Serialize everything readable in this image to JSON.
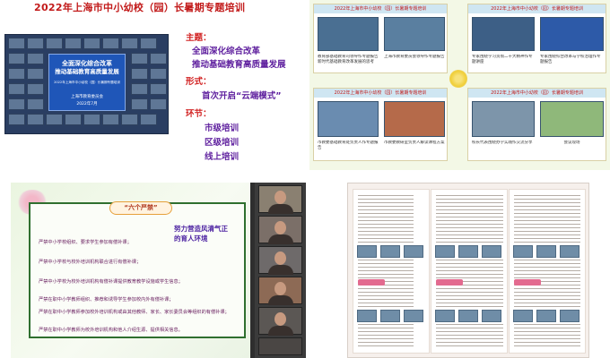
{
  "top_left": {
    "title": "2022年上海市中小幼校（园）长暑期专题培训",
    "theme_label": "主题：",
    "theme_line1": "全面深化综合改革",
    "theme_line2": "推动基础教育高质量发展",
    "form_label": "形式：",
    "form_text": "首次开启“云端模式”",
    "stage_label": "环节：",
    "stages": [
      "市级培训",
      "区级培训",
      "线上培训"
    ],
    "screen_lines": [
      "全面深化综合改革",
      "推动基础教育高质量发展",
      "2022年上海市中小幼校（园）长暑期专题培训",
      "上海市教育委员会",
      "2022年7月"
    ]
  },
  "top_right": {
    "cards": [
      {
        "header": "2022年上海市中小幼校（园）长暑期专题培训",
        "caption_a": "教育部基础教育司领导作专题报告 新时代基础教育改革发展的思考",
        "caption_b": "上海市教育委员会领导作专题报告"
      },
      {
        "header": "2022年上海市中小幼校（园）长暑期专题培训",
        "caption_a": "专家围绕学习贯彻二十大精神作专题讲座",
        "caption_b": "专家围绕综合改革与学校治理作专题报告"
      },
      {
        "header": "2022年上海市中小幼校（园）长暑期专题培训",
        "caption_a": "市教委基础教育处负责人作专题报告",
        "caption_b": "市教委教研室负责人解读课程方案"
      },
      {
        "header": "2022年上海市中小幼校（园）长暑期专题培训",
        "caption_a": "校长代表围绕办学实践作交流分享",
        "caption_b": "会议现场"
      }
    ]
  },
  "bottom_left": {
    "banner": "“六个严禁”",
    "slogan": "努力营造风清气正的育人环境",
    "rules": [
      "严禁中小学校组织、要求学生参加有偿补课；",
      "严禁中小学校与校外培训机构联合进行有偿补课；",
      "严禁中小学校为校外培训机构有偿补课提供教育教学设施或学生信息；",
      "严禁在职中小学教师组织、推荐和诱导学生参加校内外有偿补课；",
      "严禁在职中小学教师参加校外培训机构或由其他教师、家长、家长委员会等组织的有偿补课；",
      "严禁在职中小学教师为校外培训机构和他人介绍生源、提供相关信息。"
    ]
  },
  "bottom_right": {
    "columns": 3
  }
}
